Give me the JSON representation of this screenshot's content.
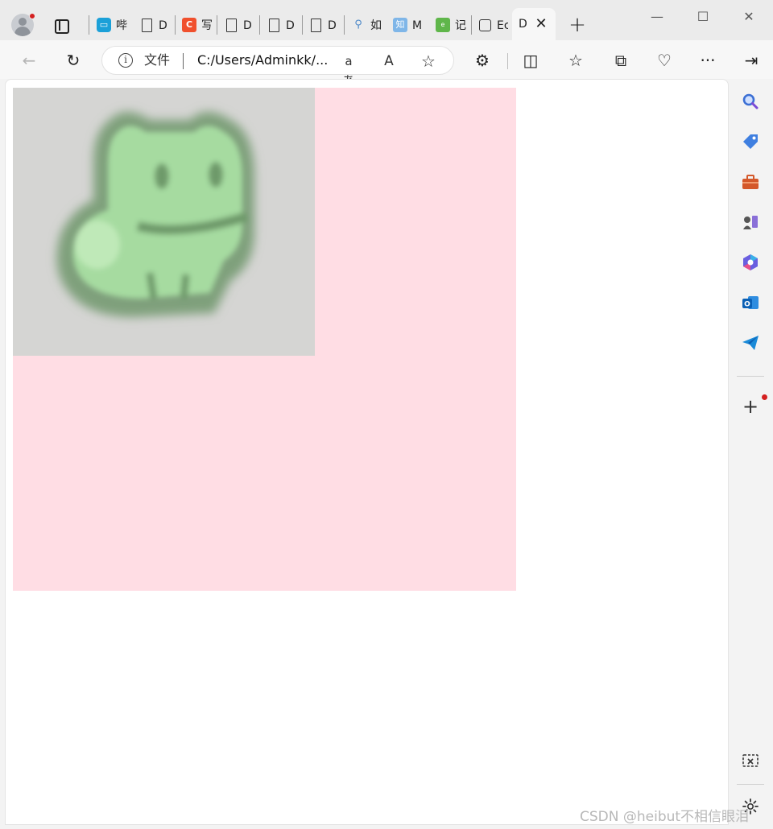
{
  "tabs": [
    {
      "icon": "bilibili-icon",
      "glyph": "tv",
      "text": "哔"
    },
    {
      "icon": "page-icon",
      "glyph": "",
      "text": "D"
    },
    {
      "icon": "csdn-icon",
      "glyph": "C",
      "text": "写"
    },
    {
      "icon": "page-icon",
      "glyph": "",
      "text": "D"
    },
    {
      "icon": "page-icon",
      "glyph": "",
      "text": "D"
    },
    {
      "icon": "page-icon",
      "glyph": "",
      "text": "D"
    },
    {
      "icon": "search-icon",
      "glyph": "🔍",
      "text": "如"
    },
    {
      "icon": "zhihu-icon",
      "glyph": "知",
      "text": "M"
    },
    {
      "icon": "green-app-icon",
      "glyph": "e",
      "text": "记"
    },
    {
      "icon": "image-icon",
      "glyph": "",
      "text": "Ec"
    }
  ],
  "active_tab": {
    "text": "D",
    "close_glyph": "✕"
  },
  "new_tab_glyph": "+",
  "window_controls": {
    "minimize": "—",
    "maximize": "☐",
    "close": "✕"
  },
  "toolbar": {
    "back": "←",
    "refresh": "↻",
    "address_label": "文件",
    "url": "C:/Users/Adminkk/...",
    "translate": "aあ",
    "read_aloud": "A",
    "favorite": "☆",
    "extensions": "⚙",
    "split": "◫",
    "favorites": "☆",
    "collections": "⧉",
    "health": "♡",
    "more": "···",
    "sidebar_toggle": "⇥"
  },
  "sidebar": {
    "icons": [
      "search-icon",
      "shopping-tag-icon",
      "tools-icon",
      "games-icon",
      "copilot-icon",
      "outlook-icon",
      "send-icon"
    ],
    "add_glyph": "+"
  },
  "page": {
    "image_alt": "frog"
  },
  "watermark": "CSDN @heibut不相信眼泪",
  "colors": {
    "pink_box": "#ffdde4",
    "image_bg": "#d5d5d3",
    "frog_green": "#9fd89a",
    "frog_outline": "#6e9a6a"
  }
}
